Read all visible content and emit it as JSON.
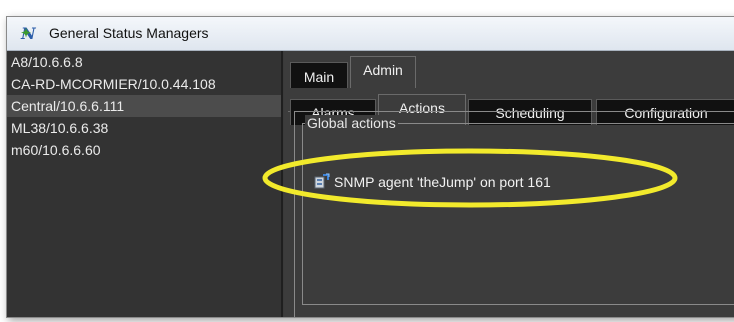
{
  "window": {
    "title": "General Status Managers",
    "icon": "igen-app-icon"
  },
  "servers": [
    "A8/10.6.6.8",
    "CA-RD-MCORMIER/10.0.44.108",
    "Central/10.6.6.111",
    "ML38/10.6.6.38",
    "m60/10.6.6.60"
  ],
  "selected_server": "Central/10.6.6.111",
  "main_tabs": {
    "main": "Main",
    "admin": "Admin"
  },
  "sub_tabs": {
    "alarms": "Alarms",
    "actions": "Actions",
    "scheduling": "Scheduling",
    "configuration": "Configuration"
  },
  "active_main_tab": "Admin",
  "active_sub_tab": "Actions",
  "global_actions": {
    "title": "Global actions",
    "items": [
      {
        "label": "SNMP agent 'theJump' on port 161",
        "icon": "snmp-agent-icon"
      }
    ]
  },
  "annotation": {
    "color": "#f2ea2c"
  }
}
